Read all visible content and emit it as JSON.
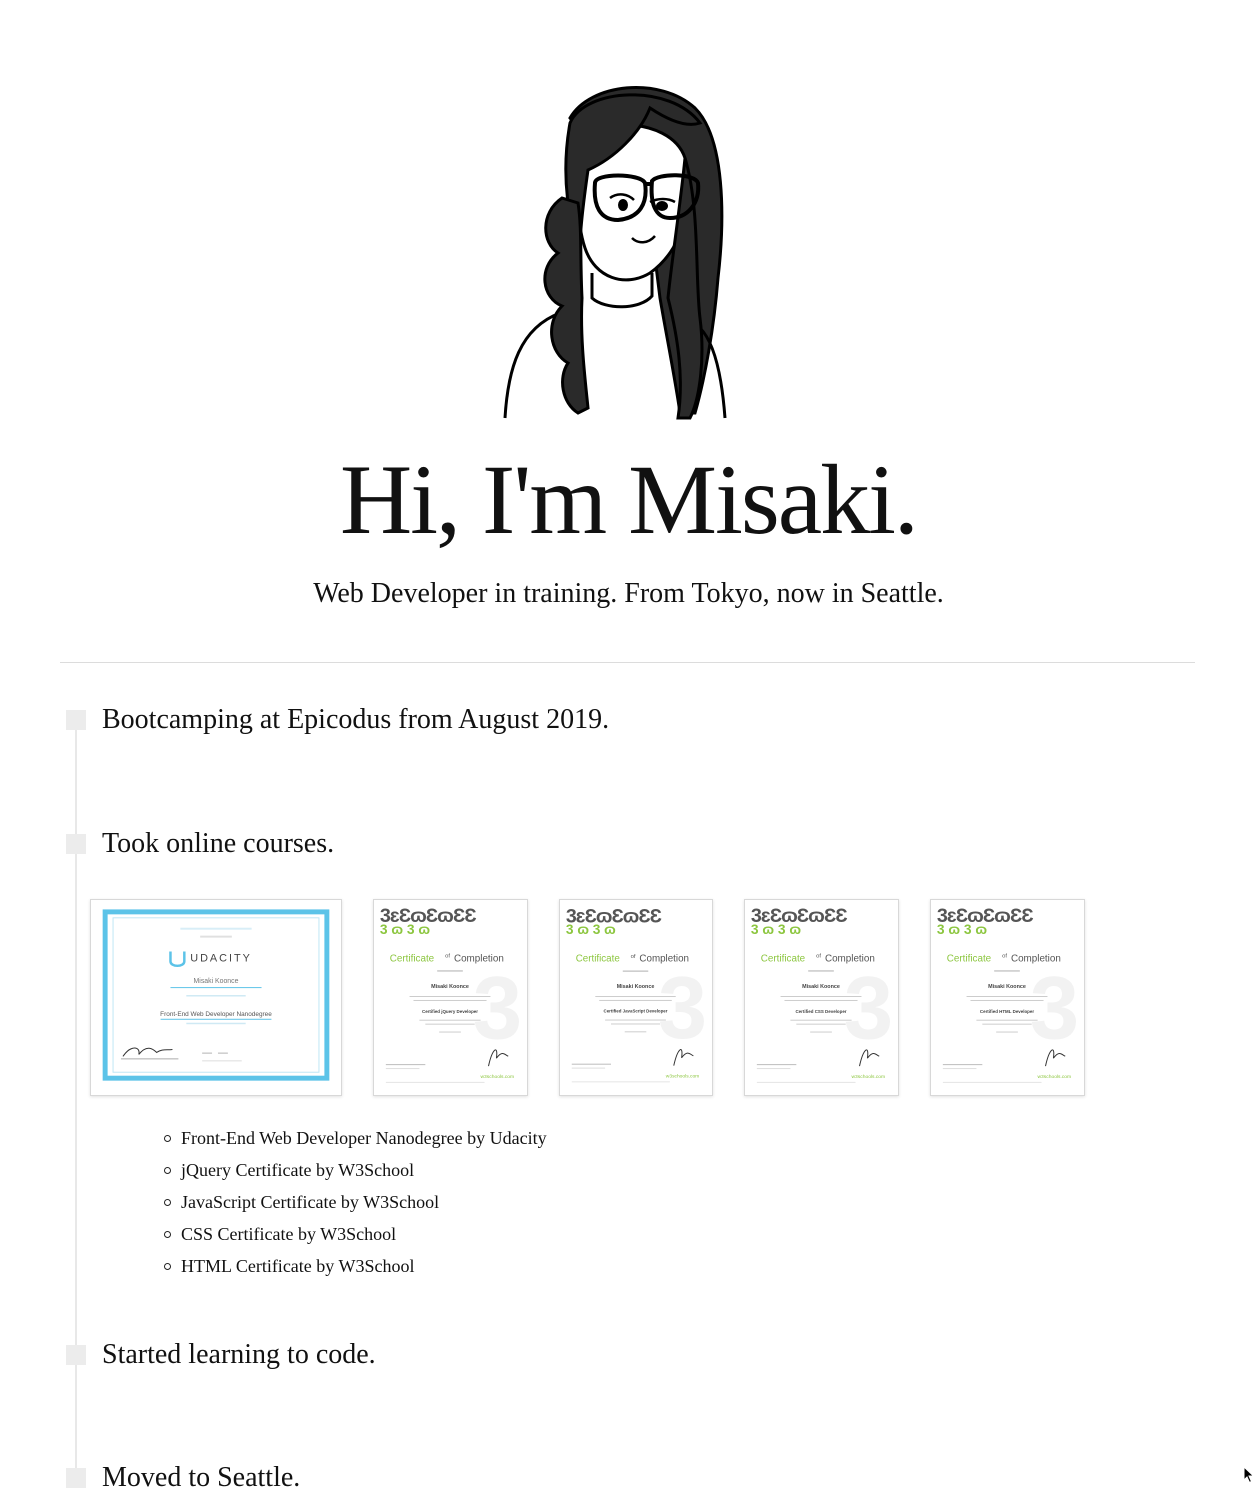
{
  "hero": {
    "title": "Hi, I'm Misaki.",
    "subtitle": "Web Developer in training. From Tokyo, now in Seattle."
  },
  "timeline": [
    {
      "heading": "Bootcamping at Epicodus from August 2019."
    },
    {
      "heading": "Took online courses."
    },
    {
      "heading": "Started learning to code."
    },
    {
      "heading": "Moved to Seattle."
    }
  ],
  "certificates": {
    "udacity": {
      "brand": "UDACITY",
      "name": "Misaki Koonce",
      "program": "Front-End Web Developer Nanodegree"
    },
    "w3": [
      {
        "title_a": "Certificate",
        "title_of": "of",
        "title_b": "Completion",
        "name": "Misaki Koonce",
        "cert": "Certified jQuery Developer",
        "brand": "w3schools.com"
      },
      {
        "title_a": "Certificate",
        "title_of": "of",
        "title_b": "Completion",
        "name": "Misaki Koonce",
        "cert": "Certified JavaScript Developer",
        "brand": "w3schools.com"
      },
      {
        "title_a": "Certificate",
        "title_of": "of",
        "title_b": "Completion",
        "name": "Misaki Koonce",
        "cert": "Certified CSS Developer",
        "brand": "w3schools.com"
      },
      {
        "title_a": "Certificate",
        "title_of": "of",
        "title_b": "Completion",
        "name": "Misaki Koonce",
        "cert": "Certified HTML Developer",
        "brand": "w3schools.com"
      }
    ]
  },
  "courses": [
    "Front-End Web Developer Nanodegree by Udacity",
    "jQuery Certificate by W3School",
    "JavaScript Certificate by W3School",
    "CSS Certificate by W3School",
    "HTML Certificate by W3School"
  ],
  "colors": {
    "udacity_blue": "#5cc3e8",
    "w3_green": "#8cc63f",
    "divider": "#dcdcdc",
    "marker": "#ececec"
  }
}
